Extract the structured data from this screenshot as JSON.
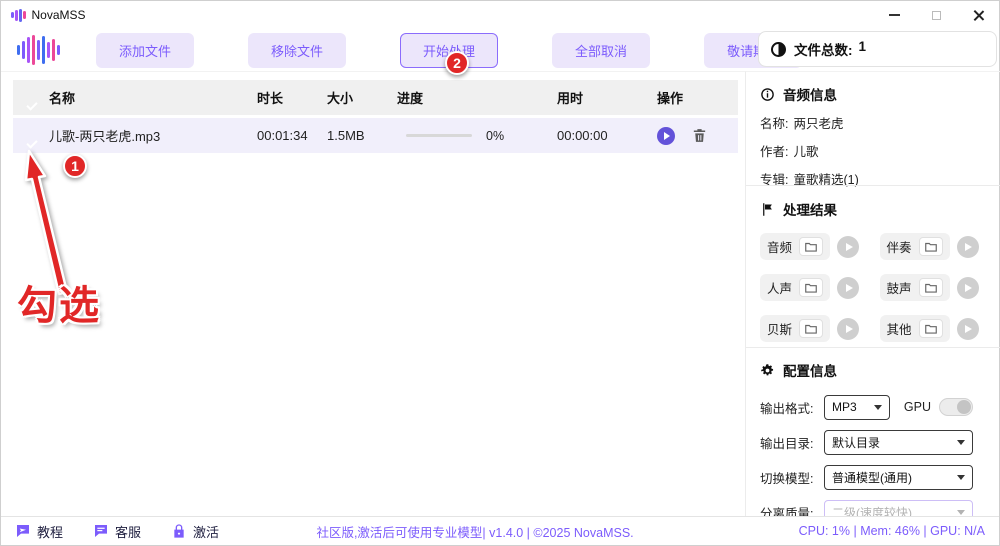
{
  "window": {
    "title": "NovaMSS"
  },
  "toolbar": {
    "buttons": [
      {
        "label": "添加文件"
      },
      {
        "label": "移除文件"
      },
      {
        "label": "开始处理"
      },
      {
        "label": "全部取消"
      },
      {
        "label": "敬请期待"
      }
    ]
  },
  "file_summary": {
    "label": "文件总数:",
    "count": "1"
  },
  "table": {
    "headers": {
      "name": "名称",
      "duration": "时长",
      "size": "大小",
      "progress": "进度",
      "elapsed": "用时",
      "actions": "操作"
    },
    "rows": [
      {
        "name": "儿歌-两只老虎.mp3",
        "duration": "00:01:34",
        "size": "1.5MB",
        "progress": "0%",
        "elapsed": "00:00:00"
      }
    ]
  },
  "annotations": {
    "badge1": "1",
    "badge2": "2",
    "check_label": "勾选"
  },
  "audio_info": {
    "title": "音频信息",
    "fields": [
      {
        "label": "名称:",
        "value": "两只老虎"
      },
      {
        "label": "作者:",
        "value": "儿歌"
      },
      {
        "label": "专辑:",
        "value": "童歌精选(1)"
      }
    ]
  },
  "results": {
    "title": "处理结果",
    "items": [
      {
        "label": "音频"
      },
      {
        "label": "伴奏"
      },
      {
        "label": "人声"
      },
      {
        "label": "鼓声"
      },
      {
        "label": "贝斯"
      },
      {
        "label": "其他"
      }
    ]
  },
  "config": {
    "title": "配置信息",
    "rows": {
      "format": {
        "label": "输出格式:",
        "value": "MP3"
      },
      "gpu": {
        "label": "GPU"
      },
      "dir": {
        "label": "输出目录:",
        "value": "默认目录"
      },
      "model": {
        "label": "切换模型:",
        "value": "普通模型(通用)"
      },
      "quality": {
        "label": "分离质量:",
        "value": "二级(速度较快)"
      }
    }
  },
  "statusbar": {
    "tutorial": "教程",
    "support": "客服",
    "activate": "激活",
    "center": "社区版,激活后可使用专业模型| v1.4.0 | ©2025 NovaMSS.",
    "metrics": "CPU: 1% | Mem: 46% | GPU: N/A"
  },
  "colors": {
    "accent": "#7c5cfc",
    "accent_light": "#ece6fb",
    "checkbox": "#4f46e5",
    "annotation_red": "#e12727"
  }
}
